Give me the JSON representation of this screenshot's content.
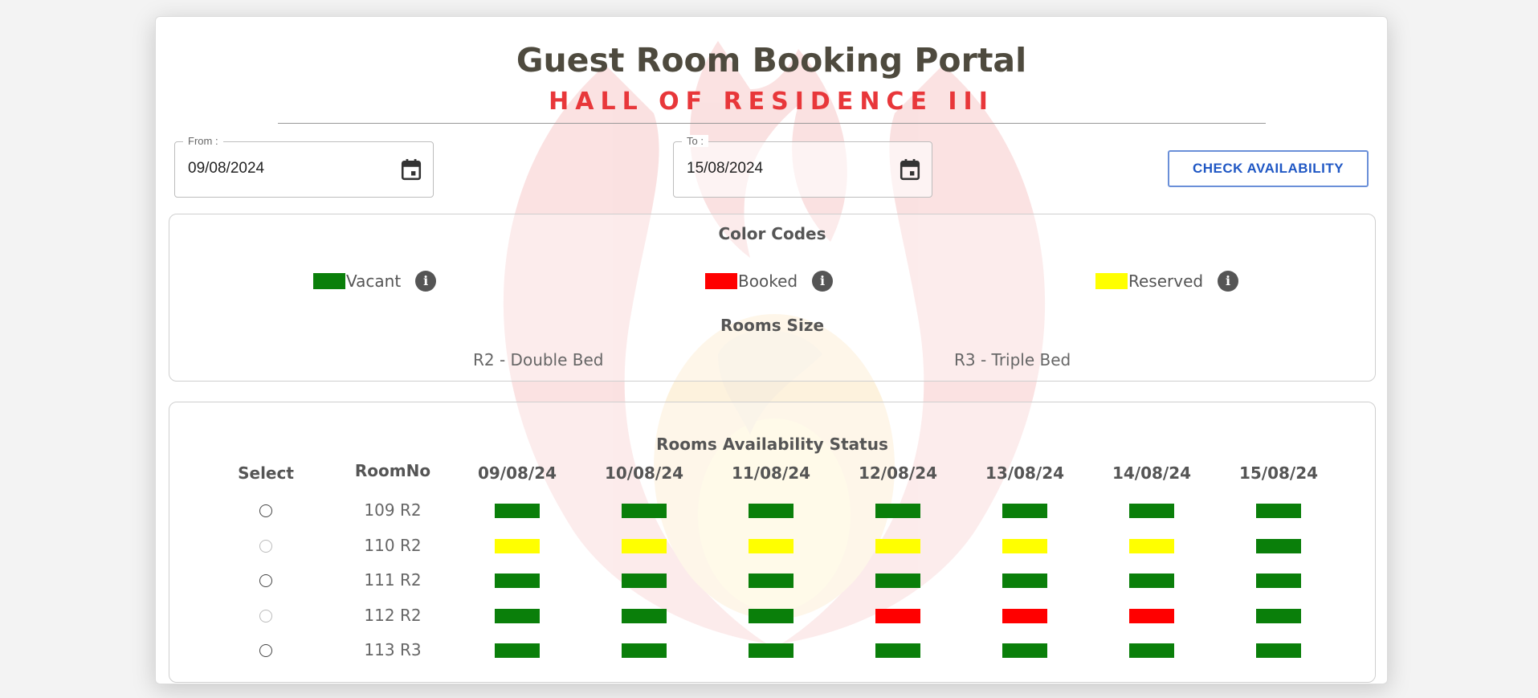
{
  "header": {
    "title": "Guest Room Booking Portal",
    "subtitle": "HALL OF RESIDENCE III"
  },
  "dates": {
    "from_label": "From :",
    "from_value": "09/08/2024",
    "to_label": "To :",
    "to_value": "15/08/2024"
  },
  "check_button_label": "CHECK AVAILABILITY",
  "color_codes": {
    "title": "Color Codes",
    "items": [
      {
        "label": "Vacant",
        "color": "#0a7f0a"
      },
      {
        "label": "Booked",
        "color": "#ff0000"
      },
      {
        "label": "Reserved",
        "color": "#ffff00"
      }
    ]
  },
  "room_sizes": {
    "title": "Rooms Size",
    "items": [
      "R2 - Double Bed",
      "R3 - Triple Bed"
    ]
  },
  "availability": {
    "title": "Rooms Availability Status",
    "select_header": "Select",
    "room_header": "RoomNo",
    "dates": [
      "09/08/24",
      "10/08/24",
      "11/08/24",
      "12/08/24",
      "13/08/24",
      "14/08/24",
      "15/08/24"
    ],
    "rooms": [
      {
        "room": "109 R2",
        "selectable": true,
        "status": [
          "vacant",
          "vacant",
          "vacant",
          "vacant",
          "vacant",
          "vacant",
          "vacant"
        ]
      },
      {
        "room": "110 R2",
        "selectable": false,
        "status": [
          "reserved",
          "reserved",
          "reserved",
          "reserved",
          "reserved",
          "reserved",
          "vacant"
        ]
      },
      {
        "room": "111 R2",
        "selectable": true,
        "status": [
          "vacant",
          "vacant",
          "vacant",
          "vacant",
          "vacant",
          "vacant",
          "vacant"
        ]
      },
      {
        "room": "112 R2",
        "selectable": false,
        "status": [
          "vacant",
          "vacant",
          "vacant",
          "booked",
          "booked",
          "booked",
          "vacant"
        ]
      },
      {
        "room": "113 R3",
        "selectable": true,
        "status": [
          "vacant",
          "vacant",
          "vacant",
          "vacant",
          "vacant",
          "vacant",
          "vacant"
        ]
      }
    ],
    "status_colors": {
      "vacant": "#0a7f0a",
      "booked": "#ff0000",
      "reserved": "#ffff00"
    }
  }
}
